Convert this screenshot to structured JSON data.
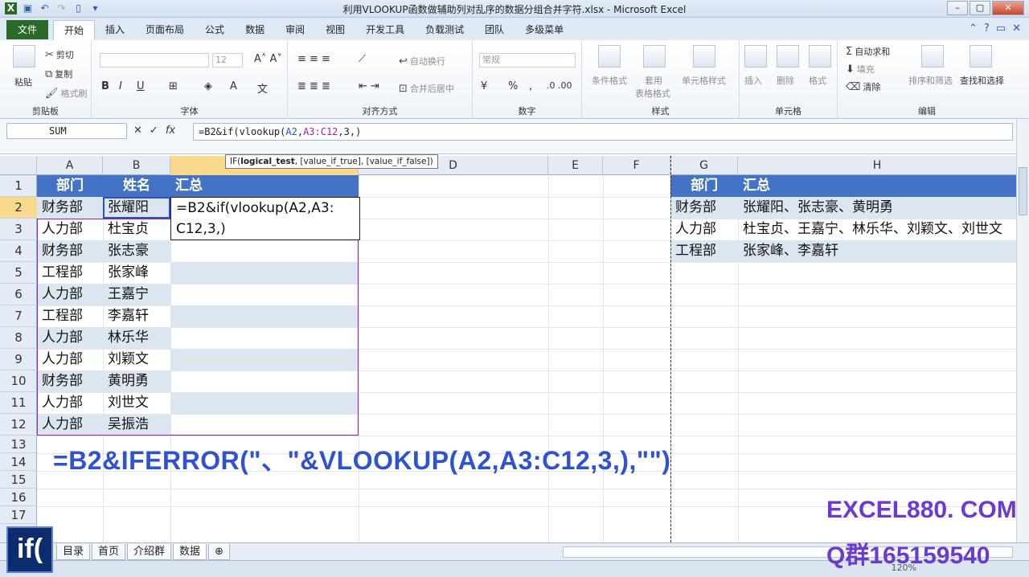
{
  "window": {
    "title": "利用VLOOKUP函数做辅助列对乱序的数据分组合并字符.xlsx - Microsoft Excel"
  },
  "ribbon_tabs": {
    "file": "文件",
    "tabs": [
      "开始",
      "插入",
      "页面布局",
      "公式",
      "数据",
      "审阅",
      "视图",
      "开发工具",
      "负载测试",
      "团队",
      "多级菜单"
    ]
  },
  "ribbon": {
    "clipboard": {
      "paste": "粘贴",
      "cut": "剪切",
      "copy": "复制",
      "format_painter": "格式刷",
      "group": "剪贴板"
    },
    "font": {
      "size": "12",
      "bold": "B",
      "italic": "I",
      "underline": "U",
      "group": "字体"
    },
    "alignment": {
      "wrap": "自动换行",
      "merge": "合并后居中",
      "group": "对齐方式"
    },
    "number": {
      "format": "常规",
      "percent": "%",
      "comma": ",",
      "group": "数字"
    },
    "styles": {
      "cond": "条件格式",
      "table1": "套用",
      "table2": "表格格式",
      "cell": "单元格样式",
      "group": "样式"
    },
    "cells": {
      "insert": "插入",
      "delete": "删除",
      "format": "格式",
      "group": "单元格"
    },
    "editing": {
      "autosum": "自动求和",
      "fill": "填充",
      "clear": "清除",
      "sort": "排序和筛选",
      "find": "查找和选择",
      "group": "编辑"
    }
  },
  "formula_bar": {
    "name_box": "SUM",
    "cancel": "✕",
    "enter": "✓",
    "fx": "fx",
    "prefix": "=B2&if(vlookup(",
    "ref1": "A2",
    "sep": ",",
    "ref2": "A3:C12",
    "suffix": ",3,)"
  },
  "tooltip": {
    "fn": "IF(",
    "arg1": "logical_test",
    "rest": ", [value_if_true], [value_if_false])"
  },
  "columns": [
    "A",
    "B",
    "C",
    "D",
    "E",
    "F",
    "G",
    "H"
  ],
  "rows": [
    "1",
    "2",
    "3",
    "4",
    "5",
    "6",
    "7",
    "8",
    "9",
    "10",
    "11",
    "12",
    "13",
    "14",
    "15",
    "16",
    "17"
  ],
  "table_left": {
    "headers": [
      "部门",
      "姓名",
      "汇总"
    ],
    "rows": [
      [
        "财务部",
        "张耀阳"
      ],
      [
        "人力部",
        "杜宝贞"
      ],
      [
        "财务部",
        "张志豪"
      ],
      [
        "工程部",
        "张家峰"
      ],
      [
        "人力部",
        "王嘉宁"
      ],
      [
        "工程部",
        "李嘉轩"
      ],
      [
        "人力部",
        "林乐华"
      ],
      [
        "人力部",
        "刘颖文"
      ],
      [
        "财务部",
        "黄明勇"
      ],
      [
        "人力部",
        "刘世文"
      ],
      [
        "人力部",
        "吴振浩"
      ]
    ],
    "editing_text_1": "=B2&if(vlookup(A2,A3:",
    "editing_text_2": "C12,3,)"
  },
  "table_right": {
    "headers": [
      "部门",
      "汇总"
    ],
    "rows": [
      [
        "财务部",
        "张耀阳、张志豪、黄明勇"
      ],
      [
        "人力部",
        "杜宝贞、王嘉宁、林乐华、刘颖文、刘世文"
      ],
      [
        "工程部",
        "张家峰、李嘉轩"
      ]
    ]
  },
  "overlay": {
    "formula": "=B2&IFERROR(\"、\"&VLOOKUP(A2,A3:C12,3,),\"\")",
    "watermark1": "EXCEL880. COM",
    "watermark2": "Q群165159540",
    "logo": "if("
  },
  "sheets": {
    "tabs": [
      "目录",
      "首页",
      "介绍群",
      "数据"
    ],
    "active": "数据"
  },
  "status": {
    "zoom": "120%"
  },
  "colors": {
    "header_blue": "#4472c4",
    "band": "#dce6f1",
    "file_tab": "#2a6a28"
  }
}
